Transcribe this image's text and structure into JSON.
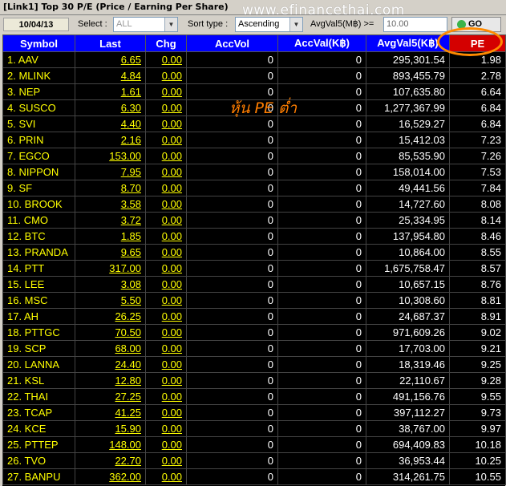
{
  "window": {
    "title": "[Link1] Top 30 P/E (Price / Earning Per Share)"
  },
  "watermark": "www.efinancethai.com",
  "toolbar": {
    "date": "10/04/13",
    "select_label": "Select :",
    "select_value": "ALL",
    "sort_label": "Sort type :",
    "sort_value": "Ascending",
    "avgval_label": "AvgVal5(M฿) >=",
    "avgval_placeholder": "10.00",
    "go_label": "GO"
  },
  "annotation": {
    "text": "หุ้น PE ต่ำ",
    "color": "#ff7e00",
    "highlight_color": "#ff8a00"
  },
  "colors": {
    "header_bg": "#0000ff",
    "pe_header_bg": "#d40000",
    "symbol": "#ffff00",
    "value": "#ffffff",
    "grid_bg": "#000000"
  },
  "table": {
    "columns": [
      "Symbol",
      "Last",
      "Chg",
      "AccVol",
      "AccVal(K฿)",
      "AvgVal5(K฿)",
      "PE"
    ],
    "rows": [
      {
        "symbol": "1. AAV",
        "last": "6.65",
        "chg": "0.00",
        "accvol": "0",
        "accval": "0",
        "avgval5": "295,301.54",
        "pe": "1.98"
      },
      {
        "symbol": "2. MLINK",
        "last": "4.84",
        "chg": "0.00",
        "accvol": "0",
        "accval": "0",
        "avgval5": "893,455.79",
        "pe": "2.78"
      },
      {
        "symbol": "3. NEP",
        "last": "1.61",
        "chg": "0.00",
        "accvol": "0",
        "accval": "0",
        "avgval5": "107,635.80",
        "pe": "6.64"
      },
      {
        "symbol": "4. SUSCO",
        "last": "6.30",
        "chg": "0.00",
        "accvol": "0",
        "accval": "0",
        "avgval5": "1,277,367.99",
        "pe": "6.84"
      },
      {
        "symbol": "5. SVI",
        "last": "4.40",
        "chg": "0.00",
        "accvol": "0",
        "accval": "0",
        "avgval5": "16,529.27",
        "pe": "6.84"
      },
      {
        "symbol": "6. PRIN",
        "last": "2.16",
        "chg": "0.00",
        "accvol": "0",
        "accval": "0",
        "avgval5": "15,412.03",
        "pe": "7.23"
      },
      {
        "symbol": "7. EGCO",
        "last": "153.00",
        "chg": "0.00",
        "accvol": "0",
        "accval": "0",
        "avgval5": "85,535.90",
        "pe": "7.26"
      },
      {
        "symbol": "8. NIPPON",
        "last": "7.95",
        "chg": "0.00",
        "accvol": "0",
        "accval": "0",
        "avgval5": "158,014.00",
        "pe": "7.53"
      },
      {
        "symbol": "9. SF",
        "last": "8.70",
        "chg": "0.00",
        "accvol": "0",
        "accval": "0",
        "avgval5": "49,441.56",
        "pe": "7.84"
      },
      {
        "symbol": "10. BROOK",
        "last": "3.58",
        "chg": "0.00",
        "accvol": "0",
        "accval": "0",
        "avgval5": "14,727.60",
        "pe": "8.08"
      },
      {
        "symbol": "11. CMO",
        "last": "3.72",
        "chg": "0.00",
        "accvol": "0",
        "accval": "0",
        "avgval5": "25,334.95",
        "pe": "8.14"
      },
      {
        "symbol": "12. BTC",
        "last": "1.85",
        "chg": "0.00",
        "accvol": "0",
        "accval": "0",
        "avgval5": "137,954.80",
        "pe": "8.46"
      },
      {
        "symbol": "13. PRANDA",
        "last": "9.65",
        "chg": "0.00",
        "accvol": "0",
        "accval": "0",
        "avgval5": "10,864.00",
        "pe": "8.55"
      },
      {
        "symbol": "14. PTT",
        "last": "317.00",
        "chg": "0.00",
        "accvol": "0",
        "accval": "0",
        "avgval5": "1,675,758.47",
        "pe": "8.57"
      },
      {
        "symbol": "15. LEE",
        "last": "3.08",
        "chg": "0.00",
        "accvol": "0",
        "accval": "0",
        "avgval5": "10,657.15",
        "pe": "8.76"
      },
      {
        "symbol": "16. MSC",
        "last": "5.50",
        "chg": "0.00",
        "accvol": "0",
        "accval": "0",
        "avgval5": "10,308.60",
        "pe": "8.81"
      },
      {
        "symbol": "17. AH",
        "last": "26.25",
        "chg": "0.00",
        "accvol": "0",
        "accval": "0",
        "avgval5": "24,687.37",
        "pe": "8.91"
      },
      {
        "symbol": "18. PTTGC",
        "last": "70.50",
        "chg": "0.00",
        "accvol": "0",
        "accval": "0",
        "avgval5": "971,609.26",
        "pe": "9.02"
      },
      {
        "symbol": "19. SCP",
        "last": "68.00",
        "chg": "0.00",
        "accvol": "0",
        "accval": "0",
        "avgval5": "17,703.00",
        "pe": "9.21"
      },
      {
        "symbol": "20. LANNA",
        "last": "24.40",
        "chg": "0.00",
        "accvol": "0",
        "accval": "0",
        "avgval5": "18,319.46",
        "pe": "9.25"
      },
      {
        "symbol": "21. KSL",
        "last": "12.80",
        "chg": "0.00",
        "accvol": "0",
        "accval": "0",
        "avgval5": "22,110.67",
        "pe": "9.28"
      },
      {
        "symbol": "22. THAI",
        "last": "27.25",
        "chg": "0.00",
        "accvol": "0",
        "accval": "0",
        "avgval5": "491,156.76",
        "pe": "9.55"
      },
      {
        "symbol": "23. TCAP",
        "last": "41.25",
        "chg": "0.00",
        "accvol": "0",
        "accval": "0",
        "avgval5": "397,112.27",
        "pe": "9.73"
      },
      {
        "symbol": "24. KCE",
        "last": "15.90",
        "chg": "0.00",
        "accvol": "0",
        "accval": "0",
        "avgval5": "38,767.00",
        "pe": "9.97"
      },
      {
        "symbol": "25. PTTEP",
        "last": "148.00",
        "chg": "0.00",
        "accvol": "0",
        "accval": "0",
        "avgval5": "694,409.83",
        "pe": "10.18"
      },
      {
        "symbol": "26. TVO",
        "last": "22.70",
        "chg": "0.00",
        "accvol": "0",
        "accval": "0",
        "avgval5": "36,953.44",
        "pe": "10.25"
      },
      {
        "symbol": "27. BANPU",
        "last": "362.00",
        "chg": "0.00",
        "accvol": "0",
        "accval": "0",
        "avgval5": "314,261.75",
        "pe": "10.55"
      }
    ]
  }
}
